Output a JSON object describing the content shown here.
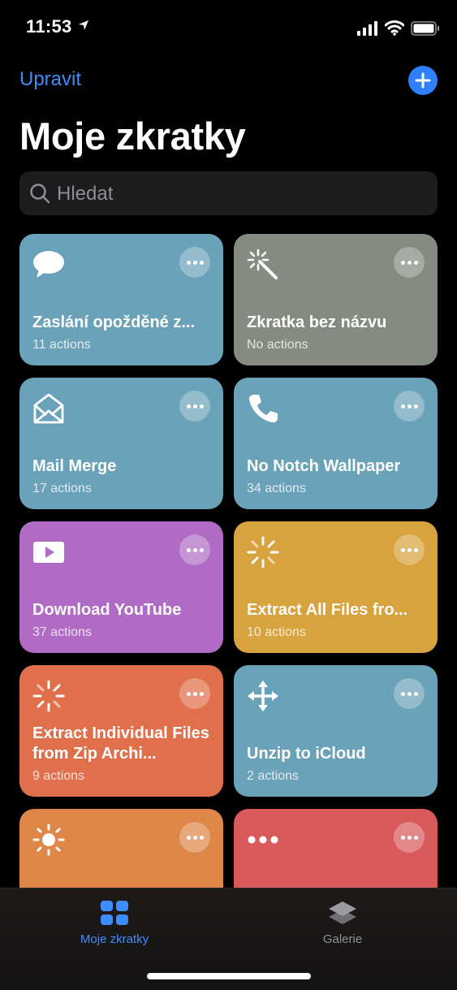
{
  "status": {
    "time": "11:53"
  },
  "header": {
    "edit_label": "Upravit",
    "title": "Moje zkratky"
  },
  "search": {
    "placeholder": "Hledat"
  },
  "shortcuts": [
    {
      "name": "Zaslání opožděné z...",
      "count": "11 actions",
      "color": "#6aa2b9",
      "icon": "message-bubble-icon"
    },
    {
      "name": "Zkratka bez názvu",
      "count": "No actions",
      "color": "#848b80",
      "icon": "magic-wand-icon"
    },
    {
      "name": "Mail Merge",
      "count": "17 actions",
      "color": "#6aa2b9",
      "icon": "open-envelope-icon"
    },
    {
      "name": "No Notch Wallpaper",
      "count": "34 actions",
      "color": "#6aa2b9",
      "icon": "phone-icon"
    },
    {
      "name": "Download YouTube",
      "count": "37 actions",
      "color": "#b06cc4",
      "icon": "play-video-icon"
    },
    {
      "name": "Extract All Files fro...",
      "count": "10 actions",
      "color": "#d8a23e",
      "icon": "loading-spinner-icon"
    },
    {
      "name": "Extract Individual Files from Zip Archi...",
      "count": "9 actions",
      "color": "#e0704c",
      "icon": "loading-spinner-icon"
    },
    {
      "name": "Unzip to iCloud",
      "count": "2 actions",
      "color": "#6aa2b9",
      "icon": "move-arrows-icon"
    },
    {
      "name": "",
      "count": "",
      "color": "#de8748",
      "icon": "sun-icon"
    },
    {
      "name": "",
      "count": "",
      "color": "#d95a5b",
      "icon": "ellipsis-icon"
    }
  ],
  "tabs": [
    {
      "label": "Moje zkratky",
      "active": true
    },
    {
      "label": "Galerie",
      "active": false
    }
  ],
  "colors": {
    "accent": "#3f8cff",
    "add_button": "#2f80ff"
  }
}
